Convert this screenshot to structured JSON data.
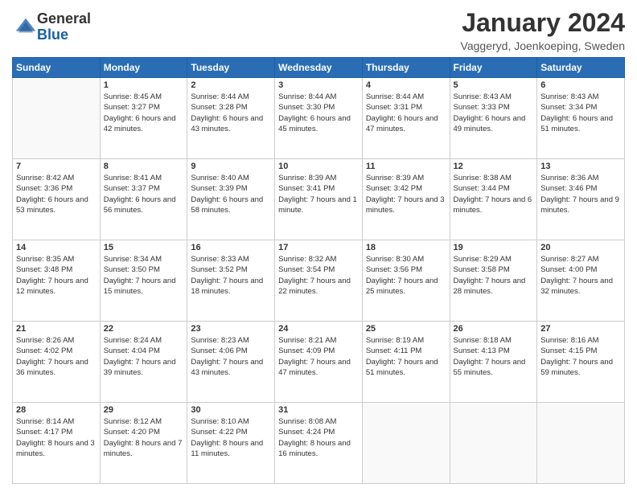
{
  "logo": {
    "general": "General",
    "blue": "Blue"
  },
  "title": "January 2024",
  "subtitle": "Vaggeryd, Joenkoeping, Sweden",
  "days_of_week": [
    "Sunday",
    "Monday",
    "Tuesday",
    "Wednesday",
    "Thursday",
    "Friday",
    "Saturday"
  ],
  "weeks": [
    [
      {
        "day": "",
        "sunrise": "",
        "sunset": "",
        "daylight": ""
      },
      {
        "day": "1",
        "sunrise": "Sunrise: 8:45 AM",
        "sunset": "Sunset: 3:27 PM",
        "daylight": "Daylight: 6 hours and 42 minutes."
      },
      {
        "day": "2",
        "sunrise": "Sunrise: 8:44 AM",
        "sunset": "Sunset: 3:28 PM",
        "daylight": "Daylight: 6 hours and 43 minutes."
      },
      {
        "day": "3",
        "sunrise": "Sunrise: 8:44 AM",
        "sunset": "Sunset: 3:30 PM",
        "daylight": "Daylight: 6 hours and 45 minutes."
      },
      {
        "day": "4",
        "sunrise": "Sunrise: 8:44 AM",
        "sunset": "Sunset: 3:31 PM",
        "daylight": "Daylight: 6 hours and 47 minutes."
      },
      {
        "day": "5",
        "sunrise": "Sunrise: 8:43 AM",
        "sunset": "Sunset: 3:33 PM",
        "daylight": "Daylight: 6 hours and 49 minutes."
      },
      {
        "day": "6",
        "sunrise": "Sunrise: 8:43 AM",
        "sunset": "Sunset: 3:34 PM",
        "daylight": "Daylight: 6 hours and 51 minutes."
      }
    ],
    [
      {
        "day": "7",
        "sunrise": "Sunrise: 8:42 AM",
        "sunset": "Sunset: 3:36 PM",
        "daylight": "Daylight: 6 hours and 53 minutes."
      },
      {
        "day": "8",
        "sunrise": "Sunrise: 8:41 AM",
        "sunset": "Sunset: 3:37 PM",
        "daylight": "Daylight: 6 hours and 56 minutes."
      },
      {
        "day": "9",
        "sunrise": "Sunrise: 8:40 AM",
        "sunset": "Sunset: 3:39 PM",
        "daylight": "Daylight: 6 hours and 58 minutes."
      },
      {
        "day": "10",
        "sunrise": "Sunrise: 8:39 AM",
        "sunset": "Sunset: 3:41 PM",
        "daylight": "Daylight: 7 hours and 1 minute."
      },
      {
        "day": "11",
        "sunrise": "Sunrise: 8:39 AM",
        "sunset": "Sunset: 3:42 PM",
        "daylight": "Daylight: 7 hours and 3 minutes."
      },
      {
        "day": "12",
        "sunrise": "Sunrise: 8:38 AM",
        "sunset": "Sunset: 3:44 PM",
        "daylight": "Daylight: 7 hours and 6 minutes."
      },
      {
        "day": "13",
        "sunrise": "Sunrise: 8:36 AM",
        "sunset": "Sunset: 3:46 PM",
        "daylight": "Daylight: 7 hours and 9 minutes."
      }
    ],
    [
      {
        "day": "14",
        "sunrise": "Sunrise: 8:35 AM",
        "sunset": "Sunset: 3:48 PM",
        "daylight": "Daylight: 7 hours and 12 minutes."
      },
      {
        "day": "15",
        "sunrise": "Sunrise: 8:34 AM",
        "sunset": "Sunset: 3:50 PM",
        "daylight": "Daylight: 7 hours and 15 minutes."
      },
      {
        "day": "16",
        "sunrise": "Sunrise: 8:33 AM",
        "sunset": "Sunset: 3:52 PM",
        "daylight": "Daylight: 7 hours and 18 minutes."
      },
      {
        "day": "17",
        "sunrise": "Sunrise: 8:32 AM",
        "sunset": "Sunset: 3:54 PM",
        "daylight": "Daylight: 7 hours and 22 minutes."
      },
      {
        "day": "18",
        "sunrise": "Sunrise: 8:30 AM",
        "sunset": "Sunset: 3:56 PM",
        "daylight": "Daylight: 7 hours and 25 minutes."
      },
      {
        "day": "19",
        "sunrise": "Sunrise: 8:29 AM",
        "sunset": "Sunset: 3:58 PM",
        "daylight": "Daylight: 7 hours and 28 minutes."
      },
      {
        "day": "20",
        "sunrise": "Sunrise: 8:27 AM",
        "sunset": "Sunset: 4:00 PM",
        "daylight": "Daylight: 7 hours and 32 minutes."
      }
    ],
    [
      {
        "day": "21",
        "sunrise": "Sunrise: 8:26 AM",
        "sunset": "Sunset: 4:02 PM",
        "daylight": "Daylight: 7 hours and 36 minutes."
      },
      {
        "day": "22",
        "sunrise": "Sunrise: 8:24 AM",
        "sunset": "Sunset: 4:04 PM",
        "daylight": "Daylight: 7 hours and 39 minutes."
      },
      {
        "day": "23",
        "sunrise": "Sunrise: 8:23 AM",
        "sunset": "Sunset: 4:06 PM",
        "daylight": "Daylight: 7 hours and 43 minutes."
      },
      {
        "day": "24",
        "sunrise": "Sunrise: 8:21 AM",
        "sunset": "Sunset: 4:09 PM",
        "daylight": "Daylight: 7 hours and 47 minutes."
      },
      {
        "day": "25",
        "sunrise": "Sunrise: 8:19 AM",
        "sunset": "Sunset: 4:11 PM",
        "daylight": "Daylight: 7 hours and 51 minutes."
      },
      {
        "day": "26",
        "sunrise": "Sunrise: 8:18 AM",
        "sunset": "Sunset: 4:13 PM",
        "daylight": "Daylight: 7 hours and 55 minutes."
      },
      {
        "day": "27",
        "sunrise": "Sunrise: 8:16 AM",
        "sunset": "Sunset: 4:15 PM",
        "daylight": "Daylight: 7 hours and 59 minutes."
      }
    ],
    [
      {
        "day": "28",
        "sunrise": "Sunrise: 8:14 AM",
        "sunset": "Sunset: 4:17 PM",
        "daylight": "Daylight: 8 hours and 3 minutes."
      },
      {
        "day": "29",
        "sunrise": "Sunrise: 8:12 AM",
        "sunset": "Sunset: 4:20 PM",
        "daylight": "Daylight: 8 hours and 7 minutes."
      },
      {
        "day": "30",
        "sunrise": "Sunrise: 8:10 AM",
        "sunset": "Sunset: 4:22 PM",
        "daylight": "Daylight: 8 hours and 11 minutes."
      },
      {
        "day": "31",
        "sunrise": "Sunrise: 8:08 AM",
        "sunset": "Sunset: 4:24 PM",
        "daylight": "Daylight: 8 hours and 16 minutes."
      },
      {
        "day": "",
        "sunrise": "",
        "sunset": "",
        "daylight": ""
      },
      {
        "day": "",
        "sunrise": "",
        "sunset": "",
        "daylight": ""
      },
      {
        "day": "",
        "sunrise": "",
        "sunset": "",
        "daylight": ""
      }
    ]
  ]
}
